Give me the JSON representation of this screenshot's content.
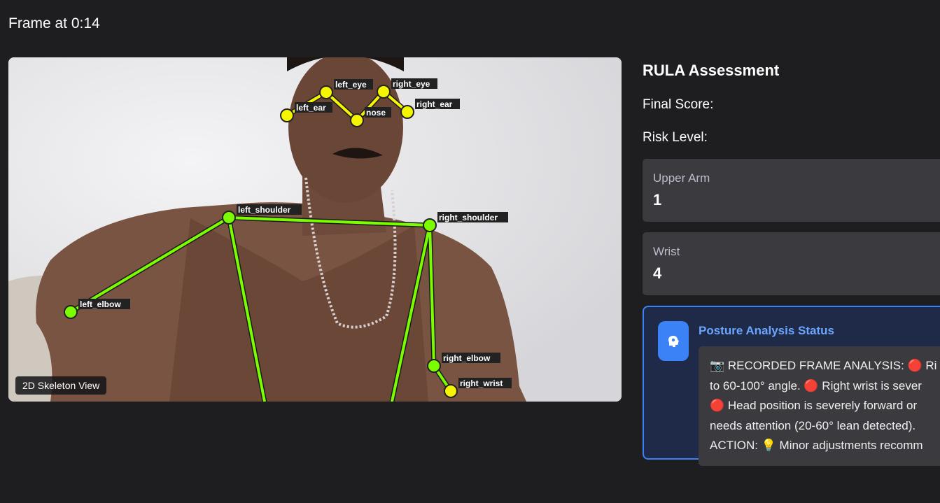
{
  "frame": {
    "title": "Frame at 0:14"
  },
  "viewer": {
    "badge": "2D Skeleton View",
    "keypoints": [
      {
        "name": "left_eye"
      },
      {
        "name": "right_eye"
      },
      {
        "name": "left_ear"
      },
      {
        "name": "nose"
      },
      {
        "name": "right_ear"
      },
      {
        "name": "left_shoulder"
      },
      {
        "name": "right_shoulder"
      },
      {
        "name": "left_elbow"
      },
      {
        "name": "right_elbow"
      },
      {
        "name": "right_wrist"
      }
    ],
    "colors": {
      "head": "#f5f500",
      "body": "#7cfc00",
      "outline": "#1a1a1a"
    }
  },
  "assessment": {
    "title": "RULA Assessment",
    "final_score_label": "Final Score:",
    "risk_level_label": "Risk Level:",
    "cards": [
      {
        "label": "Upper Arm",
        "value": "1"
      },
      {
        "label": "Wrist",
        "value": "4"
      }
    ],
    "status": {
      "title": "Posture Analysis Status",
      "icon": "brain-icon",
      "lines": [
        "📷 RECORDED FRAME ANALYSIS: 🔴 Ri",
        "to 60-100° angle. 🔴 Right wrist is sever",
        "🔴 Head position is severely forward or",
        "needs attention (20-60° lean detected).",
        "ACTION: 💡 Minor adjustments recomm"
      ]
    }
  }
}
